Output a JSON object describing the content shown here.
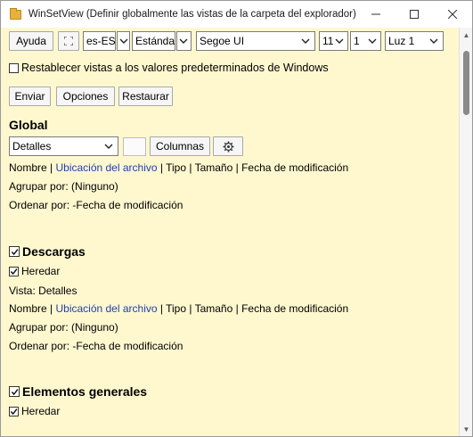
{
  "window": {
    "title": "WinSetView (Definir globalmente las vistas de la carpeta del explorador)",
    "minimize_glyph": "—",
    "maximize_glyph": "☐",
    "close_glyph": "✕"
  },
  "toolbar": {
    "help_label": "Ayuda",
    "fullscreen_glyph": "⛶",
    "language": "es-ES",
    "style": "Estándar",
    "font": "Segoe UI",
    "font_size": "11",
    "spacing": "1",
    "theme": "Luz 1"
  },
  "restore_defaults": {
    "checked": false,
    "label": "Restablecer vistas a los valores predeterminados de Windows"
  },
  "actions": {
    "submit_label": "Enviar",
    "options_label": "Opciones",
    "restore_label": "Restaurar"
  },
  "global": {
    "heading": "Global",
    "view": "Detalles",
    "columns_label": "Columnas",
    "cols_name": "Nombre",
    "cols_location": "Ubicación del archivo",
    "cols_rest": "Tipo | Tamaño | Fecha de modificación",
    "group_by": "Agrupar por: (Ninguno)",
    "sort_by": "Ordenar por: -Fecha de modificación"
  },
  "downloads": {
    "heading": "Descargas",
    "checked": true,
    "inherit_label": "Heredar",
    "inherit_checked": true,
    "view": "Vista: Detalles",
    "cols_name": "Nombre",
    "cols_location": "Ubicación del archivo",
    "cols_rest": "Tipo | Tamaño | Fecha de modificación",
    "group_by": "Agrupar por: (Ninguno)",
    "sort_by": "Ordenar por: -Fecha de modificación"
  },
  "general_items": {
    "heading": "Elementos generales",
    "checked": true,
    "inherit_label": "Heredar",
    "inherit_checked": true
  },
  "colors": {
    "content_bg": "#fff8cf",
    "link": "#1f3fb0"
  }
}
